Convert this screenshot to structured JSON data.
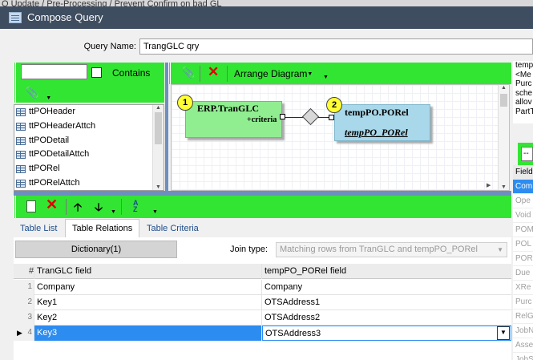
{
  "background_window": {
    "title": "Q Update / Pre-Processing / Prevent Confirm on bad GL"
  },
  "window": {
    "title": "Compose Query"
  },
  "query_name": {
    "label": "Query Name:",
    "value": "TrangGLC qry"
  },
  "table_panel": {
    "search_value": "",
    "contains_label": "Contains",
    "tables": [
      "ttPOHeader",
      "ttPOHeaderAttch",
      "ttPODetail",
      "ttPODetailAttch",
      "ttPORel",
      "ttPORelAttch"
    ]
  },
  "diagram": {
    "arrange_label": "Arrange Diagram",
    "node1": {
      "number": "1",
      "title": "ERP.TranGLC",
      "field": "+criteria"
    },
    "node2": {
      "number": "2",
      "title": "tempPO.PORel",
      "alias": "tempPO_PORel"
    }
  },
  "tabs": [
    {
      "label": "Table List",
      "active": false
    },
    {
      "label": "Table Relations",
      "active": true
    },
    {
      "label": "Table Criteria",
      "active": false
    }
  ],
  "relations": {
    "dictionary_label": "Dictionary(1)",
    "join_label": "Join type:",
    "join_value": "Matching rows from TranGLC and tempPO_PORel",
    "headers": {
      "num": "#",
      "left": "TranGLC field",
      "right": "tempPO_PORel field"
    },
    "rows": [
      {
        "num": "1",
        "left": "Company",
        "right": "Company",
        "selected": false
      },
      {
        "num": "2",
        "left": "Key1",
        "right": "OTSAddress1",
        "selected": false
      },
      {
        "num": "3",
        "left": "Key2",
        "right": "OTSAddress2",
        "selected": false
      },
      {
        "num": "4",
        "left": "Key3",
        "right": "OTSAddress3",
        "selected": true
      }
    ]
  },
  "right_panel": {
    "text_lines": [
      "temp",
      "<Me",
      "Purc",
      "sche",
      "allov",
      "PartT"
    ],
    "combo_value": "--",
    "list_header": "Field",
    "list_items": [
      "Com",
      "Ope",
      "Void",
      "POM",
      "POL",
      "POR",
      "Due",
      "XRe",
      "Purc",
      "RelG",
      "JobN",
      "Asse",
      "JobS"
    ]
  },
  "colors": {
    "toolbar_green": "#33e533",
    "title_bar": "#3f4d60",
    "selection_blue": "#2d8cf0",
    "splitter": "#6d8fc0"
  }
}
